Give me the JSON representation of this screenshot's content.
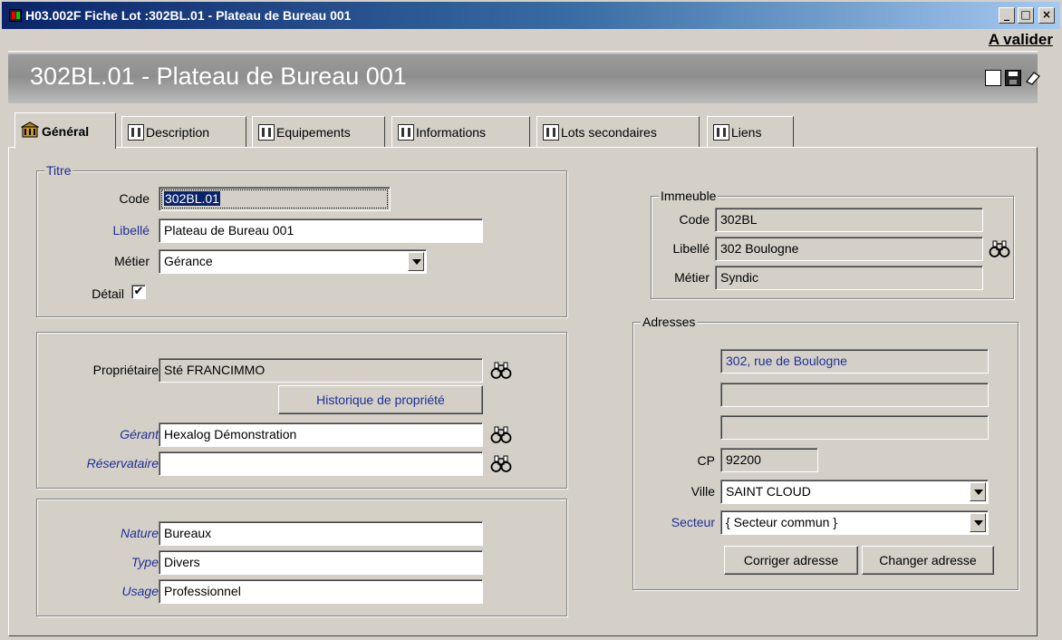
{
  "window": {
    "title": "H03.002F  Fiche Lot :302BL.01 - Plateau de Bureau 001",
    "minimize": "_",
    "maximize": "□",
    "close": "×"
  },
  "status_link": "A valider",
  "header": {
    "title": "302BL.01   -   Plateau de Bureau 001"
  },
  "tabs": [
    {
      "label": "Général",
      "icon": "building-icon",
      "active": true
    },
    {
      "label": "Description",
      "icon": "grid-icon"
    },
    {
      "label": "Equipements",
      "icon": "grid-icon"
    },
    {
      "label": "Informations",
      "icon": "book-icon"
    },
    {
      "label": "Lots secondaires",
      "icon": "list-icon"
    },
    {
      "label": "Liens",
      "icon": "link-icon"
    }
  ],
  "titre": {
    "legend": "Titre",
    "code_label": "Code",
    "code_value": "302BL.01",
    "libelle_label": "Libellé",
    "libelle_value": "Plateau de Bureau 001",
    "metier_label": "Métier",
    "metier_value": "Gérance",
    "detail_label": "Détail",
    "detail_checked": "✔"
  },
  "owner": {
    "proprietaire_label": "Propriétaire",
    "proprietaire_value": "Sté FRANCIMMO",
    "historique_button": "Historique de propriété",
    "gerant_label": "Gérant",
    "gerant_value": "Hexalog Démonstration",
    "reservataire_label": "Réservataire",
    "reservataire_value": ""
  },
  "nature": {
    "nature_label": "Nature",
    "nature_value": "Bureaux",
    "type_label": "Type",
    "type_value": "Divers",
    "usage_label": "Usage",
    "usage_value": "Professionnel"
  },
  "immeuble": {
    "legend": "Immeuble",
    "code_label": "Code",
    "code_value": "302BL",
    "libelle_label": "Libellé",
    "libelle_value": "302 Boulogne",
    "metier_label": "Métier",
    "metier_value": "Syndic"
  },
  "adresses": {
    "legend": "Adresses",
    "line1": "302, rue de Boulogne",
    "line2": "",
    "line3": "",
    "cp_label": "CP",
    "cp_value": "92200",
    "ville_label": "Ville",
    "ville_value": "SAINT CLOUD",
    "secteur_label": "Secteur",
    "secteur_value": "{ Secteur commun }",
    "corriger_button": "Corriger adresse",
    "changer_button": "Changer adresse"
  }
}
